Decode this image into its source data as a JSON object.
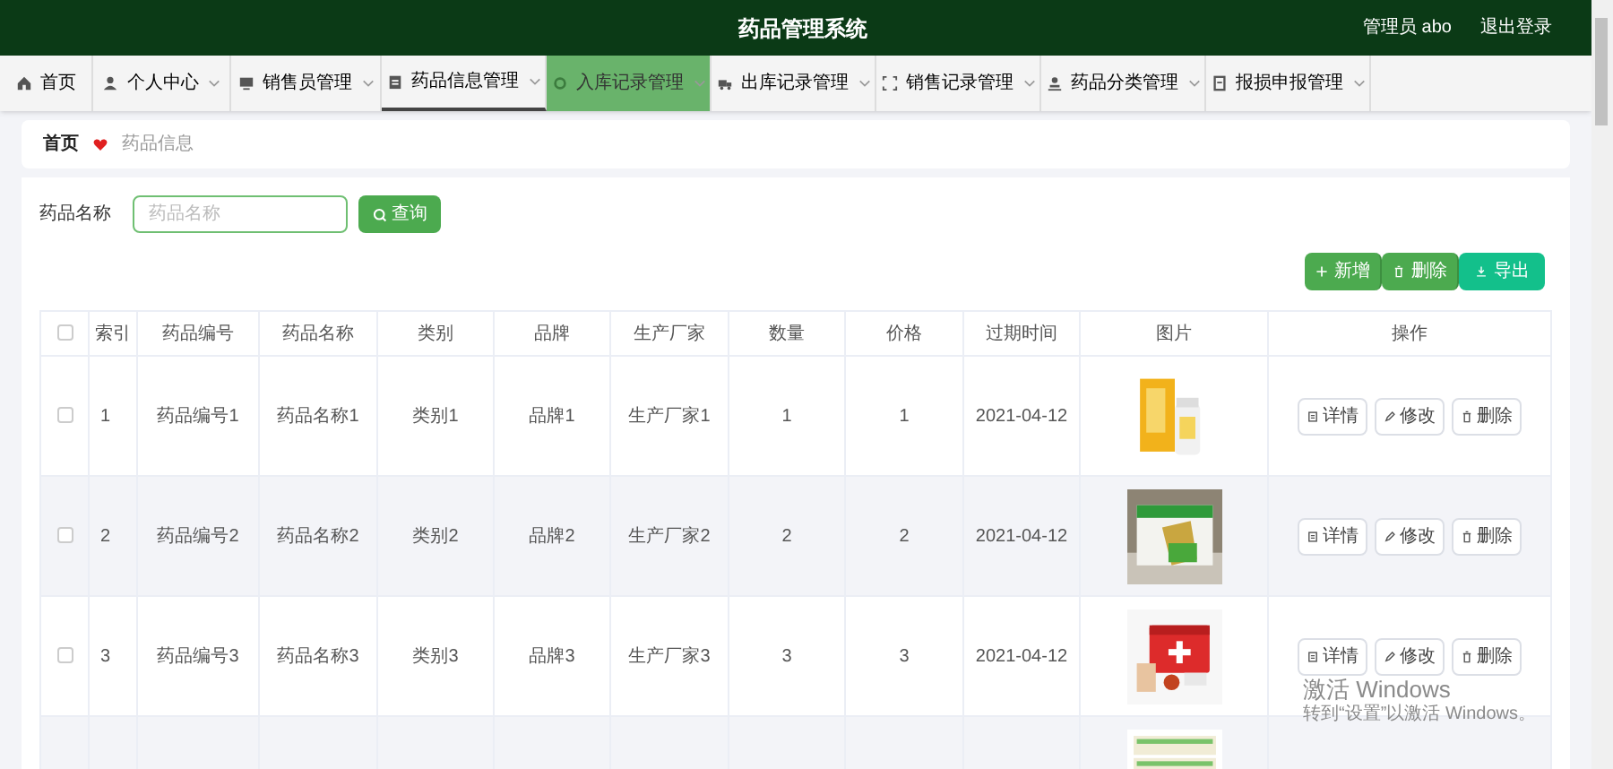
{
  "header": {
    "title": "药品管理系统",
    "user": "管理员 abo",
    "logout": "退出登录"
  },
  "nav": [
    {
      "label": "首页",
      "dropdown": false,
      "selected": false,
      "hovered": false
    },
    {
      "label": "个人中心",
      "dropdown": true,
      "selected": false,
      "hovered": false
    },
    {
      "label": "销售员管理",
      "dropdown": true,
      "selected": false,
      "hovered": false
    },
    {
      "label": "药品信息管理",
      "dropdown": true,
      "selected": true,
      "hovered": false
    },
    {
      "label": "入库记录管理",
      "dropdown": true,
      "selected": false,
      "hovered": true
    },
    {
      "label": "出库记录管理",
      "dropdown": true,
      "selected": false,
      "hovered": false
    },
    {
      "label": "销售记录管理",
      "dropdown": true,
      "selected": false,
      "hovered": false
    },
    {
      "label": "药品分类管理",
      "dropdown": true,
      "selected": false,
      "hovered": false
    },
    {
      "label": "报损申报管理",
      "dropdown": true,
      "selected": false,
      "hovered": false
    }
  ],
  "breadcrumb": [
    {
      "label": "首页"
    },
    {
      "label": "药品信息"
    }
  ],
  "search": {
    "label": "药品名称",
    "placeholder": "药品名称",
    "button": "查询"
  },
  "actions": [
    {
      "label": "新增",
      "kind": "add"
    },
    {
      "label": "删除",
      "kind": "delete"
    },
    {
      "label": "导出",
      "kind": "export"
    }
  ],
  "table": {
    "select_all_checked": false,
    "columns": [
      "索引",
      "药品编号",
      "药品名称",
      "类别",
      "品牌",
      "生产厂家",
      "数量",
      "价格",
      "过期时间",
      "图片",
      "操作"
    ],
    "rows": [
      {
        "checked": false,
        "cells": [
          "1",
          "药品编号1",
          "药品名称1",
          "类别1",
          "品牌1",
          "生产厂家1",
          "1",
          "1",
          "2021-04-12"
        ],
        "image": {
          "kind": "picture"
        },
        "buttons": [
          {
            "label": "详情",
            "kind": "detail"
          },
          {
            "label": "修改",
            "kind": "edit"
          },
          {
            "label": "删除",
            "kind": "delete"
          }
        ]
      },
      {
        "checked": false,
        "cells": [
          "2",
          "药品编号2",
          "药品名称2",
          "类别2",
          "品牌2",
          "生产厂家2",
          "2",
          "2",
          "2021-04-12"
        ],
        "image": {
          "kind": "picture"
        },
        "buttons": [
          {
            "label": "详情",
            "kind": "detail"
          },
          {
            "label": "修改",
            "kind": "edit"
          },
          {
            "label": "删除",
            "kind": "delete"
          }
        ]
      },
      {
        "checked": false,
        "cells": [
          "3",
          "药品编号3",
          "药品名称3",
          "类别3",
          "品牌3",
          "生产厂家3",
          "3",
          "3",
          "2021-04-12"
        ],
        "image": {
          "kind": "picture"
        },
        "buttons": [
          {
            "label": "详情",
            "kind": "detail"
          },
          {
            "label": "修改",
            "kind": "edit"
          },
          {
            "label": "删除",
            "kind": "delete"
          }
        ]
      },
      {
        "image": {
          "kind": "picture"
        }
      }
    ]
  },
  "windows_notice": {
    "title": "激活 Windows",
    "subtitle": "转到“设置”以激活 Windows。"
  }
}
